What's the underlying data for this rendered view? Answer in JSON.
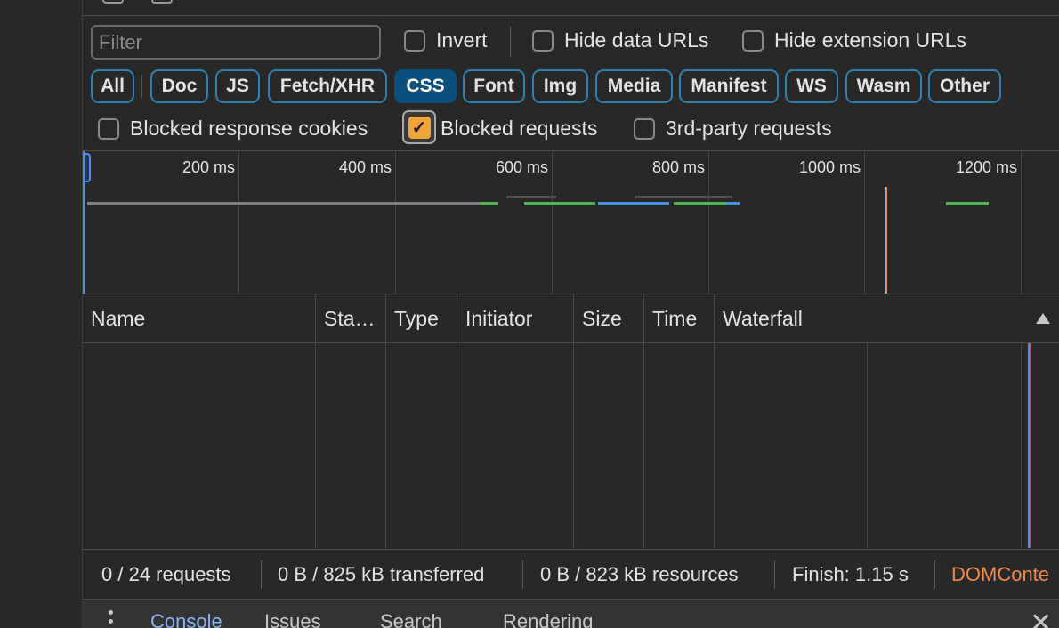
{
  "filter": {
    "placeholder": "Filter",
    "value": ""
  },
  "options": {
    "invert": {
      "label": "Invert",
      "checked": false
    },
    "hide_data_urls": {
      "label": "Hide data URLs",
      "checked": false
    },
    "hide_extension_urls": {
      "label": "Hide extension URLs",
      "checked": false
    }
  },
  "type_filters": [
    {
      "label": "All",
      "active": false
    },
    {
      "label": "Doc",
      "active": false
    },
    {
      "label": "JS",
      "active": false
    },
    {
      "label": "Fetch/XHR",
      "active": false
    },
    {
      "label": "CSS",
      "active": true
    },
    {
      "label": "Font",
      "active": false
    },
    {
      "label": "Img",
      "active": false
    },
    {
      "label": "Media",
      "active": false
    },
    {
      "label": "Manifest",
      "active": false
    },
    {
      "label": "WS",
      "active": false
    },
    {
      "label": "Wasm",
      "active": false
    },
    {
      "label": "Other",
      "active": false
    }
  ],
  "blocked": {
    "response_cookies": {
      "label": "Blocked response cookies",
      "checked": false
    },
    "requests": {
      "label": "Blocked requests",
      "checked": true
    },
    "third_party": {
      "label": "3rd-party requests",
      "checked": false
    }
  },
  "overview": {
    "tick_labels": [
      "200 ms",
      "400 ms",
      "600 ms",
      "800 ms",
      "1000 ms",
      "1200 ms"
    ]
  },
  "table": {
    "columns": [
      "Name",
      "Sta…",
      "Type",
      "Initiator",
      "Size",
      "Time",
      "Waterfall"
    ],
    "sort": "ascending"
  },
  "status": {
    "requests": "0 / 24 requests",
    "transferred": "0 B / 825 kB transferred",
    "resources": "0 B / 823 kB resources",
    "finish": "Finish: 1.15 s",
    "dom": "DOMConte"
  },
  "drawer": {
    "tabs": [
      "Console",
      "Issues",
      "Search",
      "Rendering"
    ],
    "active_tab": "Console"
  },
  "colors": {
    "accent_chip": "#0b4f7c",
    "chip_border": "#2e80b4",
    "checkbox_checked": "#f0a43a",
    "dom_content_loaded": "#f08a4b",
    "active_tab": "#8ab4f8",
    "bar_gray": "#808080",
    "bar_green": "#57b35a",
    "bar_blue": "#4b8ef0"
  }
}
